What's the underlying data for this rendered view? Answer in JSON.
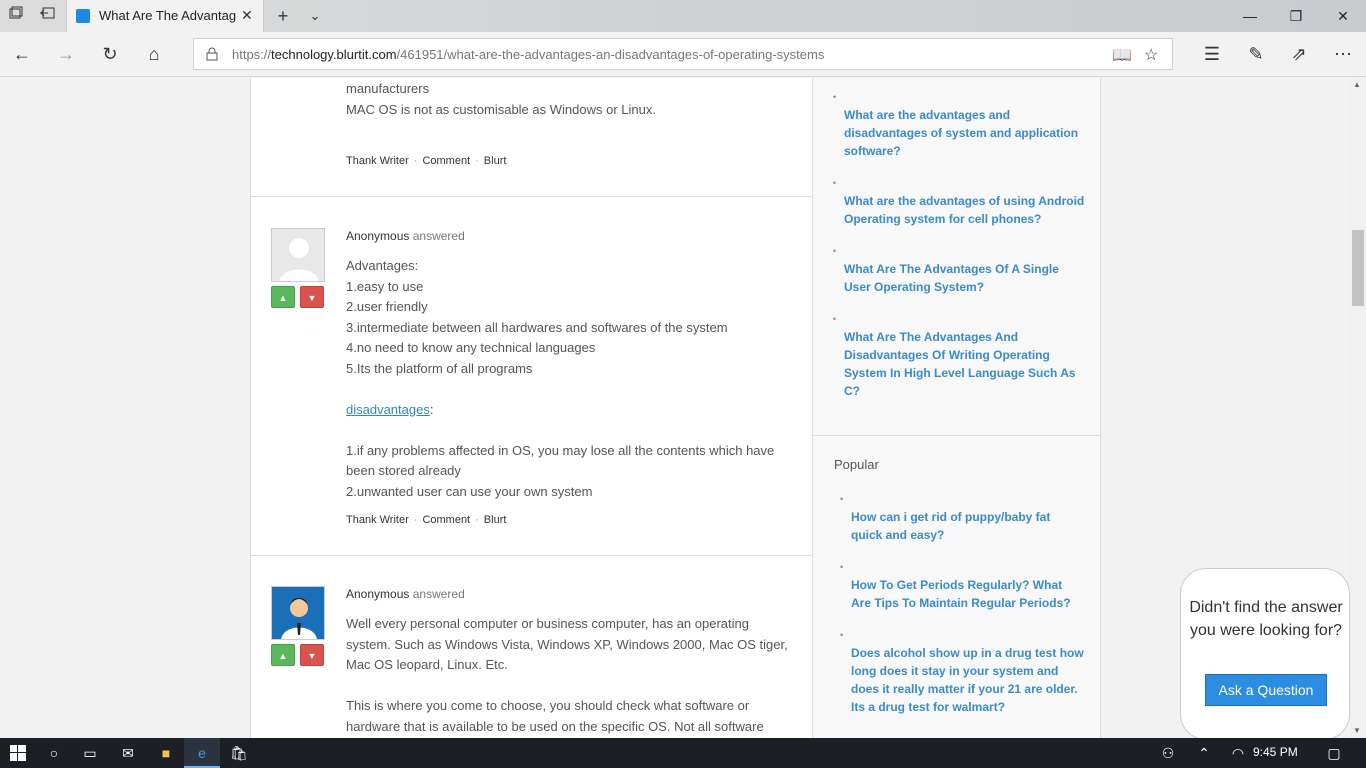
{
  "browser": {
    "tab_title": "What Are The Advantag",
    "url_prefix": "https://",
    "url_host": "technology.blurtit.com",
    "url_path": "/461951/what-are-the-advantages-an-disadvantages-of-operating-systems"
  },
  "answers": {
    "top_fragment": {
      "line1": "manufacturers",
      "line2": "MAC OS is not as customisable as Windows or Linux."
    },
    "actions": {
      "thank": "Thank Writer",
      "comment": "Comment",
      "blurt": "Blurt",
      "sep": "·"
    },
    "answer2": {
      "author": "Anonymous",
      "verb": "answered",
      "lines": [
        "Advantages:",
        "1.easy to use",
        "2.user friendly",
        "3.intermediate between all hardwares and softwares of the system",
        "4.no need to know any technical languages",
        "5.Its the platform of all programs"
      ],
      "disadv_link": "disadvantages",
      "disadv_colon": ":",
      "disadv_lines": [
        "1.if any problems affected in OS, you may lose all the contents which have been stored already",
        "2.unwanted user can use your own system"
      ]
    },
    "answer3": {
      "author": "Anonymous",
      "verb": "answered",
      "para1": "Well every personal computer or business computer, has an operating system. Such as Windows Vista, Windows XP, Windows 2000, Mac OS tiger, Mac OS leopard, Linux. Etc.",
      "para2": "This is where you come to choose, you should check what software or hardware that is available to be used on the specific OS. Not all software"
    }
  },
  "sidebar": {
    "related": [
      "What are the advantages and disadvantages of system and application software?",
      "What are the advantages of using Android Operating system for cell phones?",
      "What Are The Advantages Of A Single User Operating System?",
      "What Are The Advantages And Disadvantages Of Writing Operating System In High Level Language Such As C?"
    ],
    "popular_heading": "Popular",
    "popular": [
      "How can i get rid of puppy/baby fat quick and easy?",
      "How To Get Periods Regularly? What Are Tips To Maintain Regular Periods?",
      "Does alcohol show up in a drug test how long does it stay in your system and does it really matter if your 21 are older. Its a drug test for walmart?"
    ]
  },
  "ask_box": {
    "question": "Didn't find the answer you were looking for?",
    "button": "Ask a Question"
  },
  "taskbar": {
    "time": "9:45 PM"
  },
  "colors": {
    "link": "#3a8bc6",
    "vote_up": "#5cb85c",
    "vote_down": "#d9534f",
    "ask_button": "#2d8de0"
  }
}
